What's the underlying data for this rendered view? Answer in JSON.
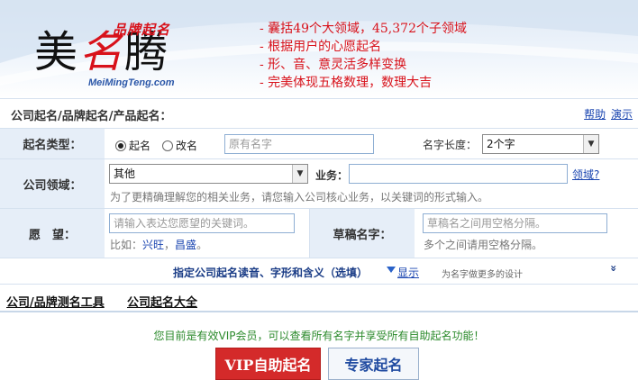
{
  "header": {
    "logo_chars": [
      "美",
      "名",
      "腾"
    ],
    "brand_tag": "品牌起名",
    "url": "MeiMingTeng.com",
    "slogans": [
      "- 囊括49个大领域，45,372个子领域",
      "- 根据用户的心愿起名",
      "- 形、音、意灵活多样变换",
      "- 完美体现五格数理，数理大吉"
    ]
  },
  "title_row": {
    "title": "公司起名/品牌起名/产品起名：",
    "help": "帮助",
    "demo": "演示"
  },
  "form": {
    "naming_type": {
      "label": "起名类型：",
      "option_new": "起名",
      "option_rename": "改名",
      "selected": "起名",
      "original_name_placeholder": "原有名字",
      "length_label": "名字长度：",
      "length_value": "2个字"
    },
    "field": {
      "label": "公司领域：",
      "field_value": "其他",
      "business_label": "业务：",
      "business_value": "",
      "domain_link": "领域?",
      "hint": "为了更精确理解您的相关业务，请您输入公司核心业务，以关键词的形式输入。"
    },
    "wish": {
      "label": "愿　望：",
      "placeholder": "请输入表达您愿望的关键词。",
      "example_prefix": "比如：",
      "example_1": "兴旺",
      "example_sep": "，",
      "example_2": "昌盛",
      "example_end": "。"
    },
    "draft": {
      "label": "草稿名字：",
      "placeholder": "草稿名之间用空格分隔。",
      "hint": "多个之间请用空格分隔。"
    },
    "pronunciation": {
      "text": "指定公司起名读音、字形和含义（选填）",
      "show": "显示",
      "design_note": "为名字做更多的设计",
      "expand": "»"
    }
  },
  "tools": {
    "link_1": "公司/品牌测名工具",
    "link_2": "公司起名大全"
  },
  "bottom": {
    "vip_message": "您目前是有效VIP会员，可以查看所有名字并享受所有自助起名功能！",
    "vip_button": "VIP自助起名",
    "expert_button": "专家起名"
  },
  "colors": {
    "brand_red": "#d8121b",
    "link_blue": "#1a45b0",
    "label_bg": "#e6eef8",
    "vip_green": "#2b8a2b",
    "vip_button_bg": "#d42a2a"
  }
}
